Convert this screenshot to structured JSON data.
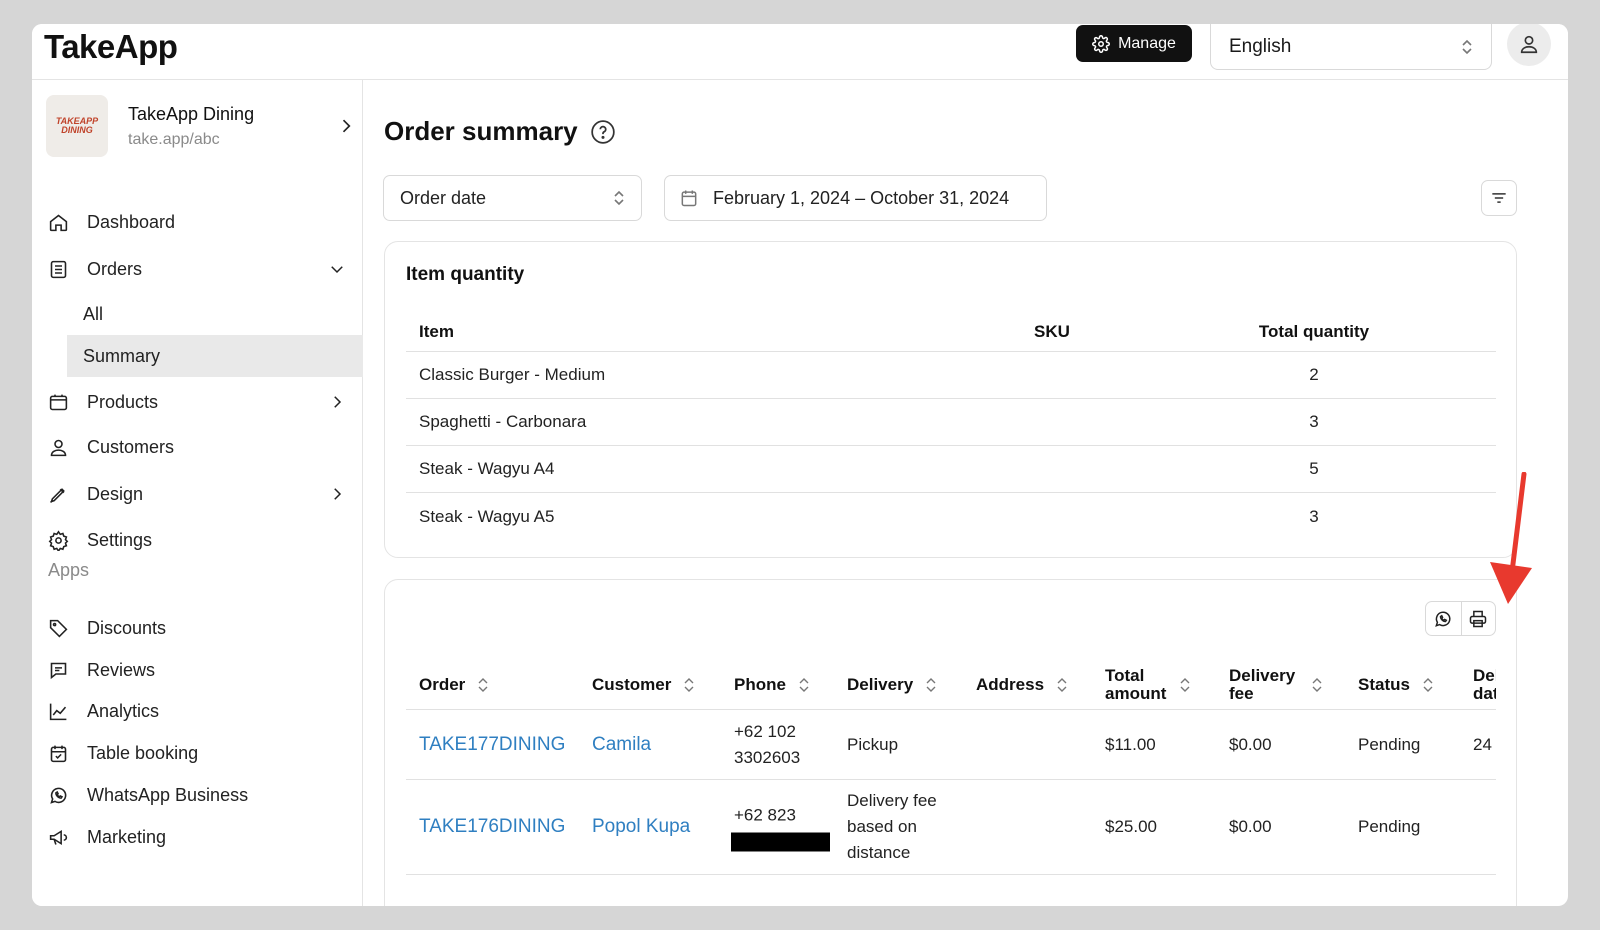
{
  "header": {
    "logo": "TakeApp",
    "manage_label": "Manage",
    "language": "English"
  },
  "store": {
    "name": "TakeApp Dining",
    "url": "take.app/abc",
    "logo_text_1": "TAKEAPP",
    "logo_text_2": "DINING"
  },
  "sidebar": {
    "items": [
      {
        "label": "Dashboard",
        "icon": "home-icon"
      },
      {
        "label": "Orders",
        "icon": "orders-icon"
      },
      {
        "label": "Products",
        "icon": "products-icon"
      },
      {
        "label": "Customers",
        "icon": "customer-icon"
      },
      {
        "label": "Design",
        "icon": "pen-icon"
      },
      {
        "label": "Settings",
        "icon": "gear-icon"
      }
    ],
    "orders_sub": [
      {
        "label": "All"
      },
      {
        "label": "Summary",
        "active": true
      }
    ],
    "apps_title": "Apps",
    "apps": [
      {
        "label": "Discounts",
        "icon": "tag-icon"
      },
      {
        "label": "Reviews",
        "icon": "review-icon"
      },
      {
        "label": "Analytics",
        "icon": "chart-icon"
      },
      {
        "label": "Table booking",
        "icon": "calendar-icon"
      },
      {
        "label": "WhatsApp Business",
        "icon": "whatsapp-icon"
      },
      {
        "label": "Marketing",
        "icon": "megaphone-icon"
      }
    ]
  },
  "main": {
    "title": "Order summary",
    "order_date_select": "Order date",
    "date_range": "February 1, 2024 – October 31, 2024",
    "item_quantity": {
      "title": "Item quantity",
      "columns": [
        "Item",
        "SKU",
        "Total quantity"
      ],
      "rows": [
        {
          "item": "Classic Burger - Medium",
          "sku": "",
          "qty": "2"
        },
        {
          "item": "Spaghetti - Carbonara",
          "sku": "",
          "qty": "3"
        },
        {
          "item": "Steak - Wagyu A4",
          "sku": "",
          "qty": "5"
        },
        {
          "item": "Steak - Wagyu A5",
          "sku": "",
          "qty": "3"
        }
      ]
    },
    "orders_table": {
      "columns": [
        "Order",
        "Customer",
        "Phone",
        "Delivery",
        "Address",
        "Total amount",
        "Delivery fee",
        "Status",
        "Delivery date"
      ],
      "rows": [
        {
          "order": "TAKE177DINING",
          "customer": "Camila",
          "phone": "+62 102 3302603",
          "delivery": "Pickup",
          "address": "",
          "total": "$11.00",
          "fee": "$0.00",
          "status": "Pending",
          "date": "24"
        },
        {
          "order": "TAKE176DINING",
          "customer": "Popol Kupa",
          "phone": "+62 823",
          "delivery": "Delivery fee based on distance",
          "address": "",
          "total": "$25.00",
          "fee": "$0.00",
          "status": "Pending",
          "date": ""
        }
      ]
    }
  },
  "colors": {
    "link": "#2f7fc1",
    "annotation_arrow": "#e8392e",
    "active_bg": "#e9e9e9"
  }
}
